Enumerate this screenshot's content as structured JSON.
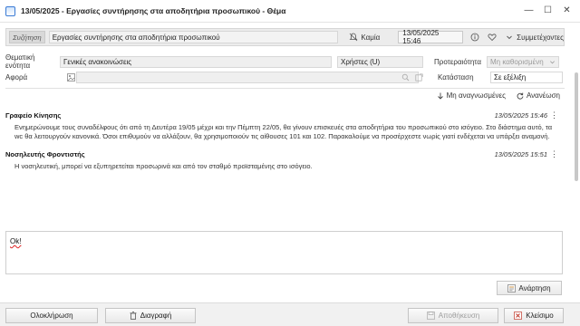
{
  "window": {
    "title": "13/05/2025 - Εργασίες συντήρησης στα αποδητήρια προσωπικού - Θέμα",
    "buttons": [
      "minimize",
      "maximize",
      "close"
    ]
  },
  "header": {
    "subject_label": "Συζήτηση",
    "subject_value": "Εργασίες συντήρησης στα αποδητήρια προσωπικού",
    "notify_label": "Καμία",
    "date_value": "13/05/2025 15:46",
    "participants_label": "Συμμετέχοντες"
  },
  "form": {
    "topic_label": "Θεματική ενότητα",
    "topic_value": "Γενικές ανακοινώσεις",
    "users_value": "Χρήστες (U)",
    "priority_label": "Προτεραιότητα",
    "priority_value": "Μη καθορισμένη",
    "regarding_label": "Αφορά",
    "status_label": "Κατάσταση",
    "status_value": "Σε εξέλιξη"
  },
  "links": {
    "unread": "Μη αναγνωσμένες",
    "refresh": "Ανανέωση"
  },
  "messages": [
    {
      "author": "Γραφείο Κίνησης",
      "date": "13/05/2025 15:46",
      "text": "Ενημερώνουμε τους συναδέλφους ότι από τη Δευτέρα 19/05 μέχρι και την Πέμπτη 22/05, θα γίνουν επισκευές στα αποδητήρια του προσωπικού στο ισόγειο. Στο διάστημα αυτό, τα wc θα λειτουργούν κανονικά. Όσοι επιθυμούν να αλλάξουν, θα χρησιμοποιούν τις αίθουσες 101 και 102. Παρακαλούμε να προσέρχεστε νωρίς γιατί ενδέχεται να υπάρξει αναμονή."
    },
    {
      "author": "Νοσηλευτής Φροντιστής",
      "date": "13/05/2025 15:51",
      "text": "Η νοσηλευτική, μπορεί να εξυπηρετείται προσωρινά και από τον σταθμό προϊσταμένης στο ισόγειο."
    }
  ],
  "reply": {
    "value": "Ok!"
  },
  "post_button": "Ανάρτηση",
  "footer": {
    "complete": "Ολοκλήρωση",
    "delete": "Διαγραφή",
    "save": "Αποθήκευση",
    "close": "Κλείσιμο"
  },
  "colors": {
    "accent": "#3a7bd5",
    "close_red": "#c0392b",
    "field_bg": "#efefef"
  }
}
